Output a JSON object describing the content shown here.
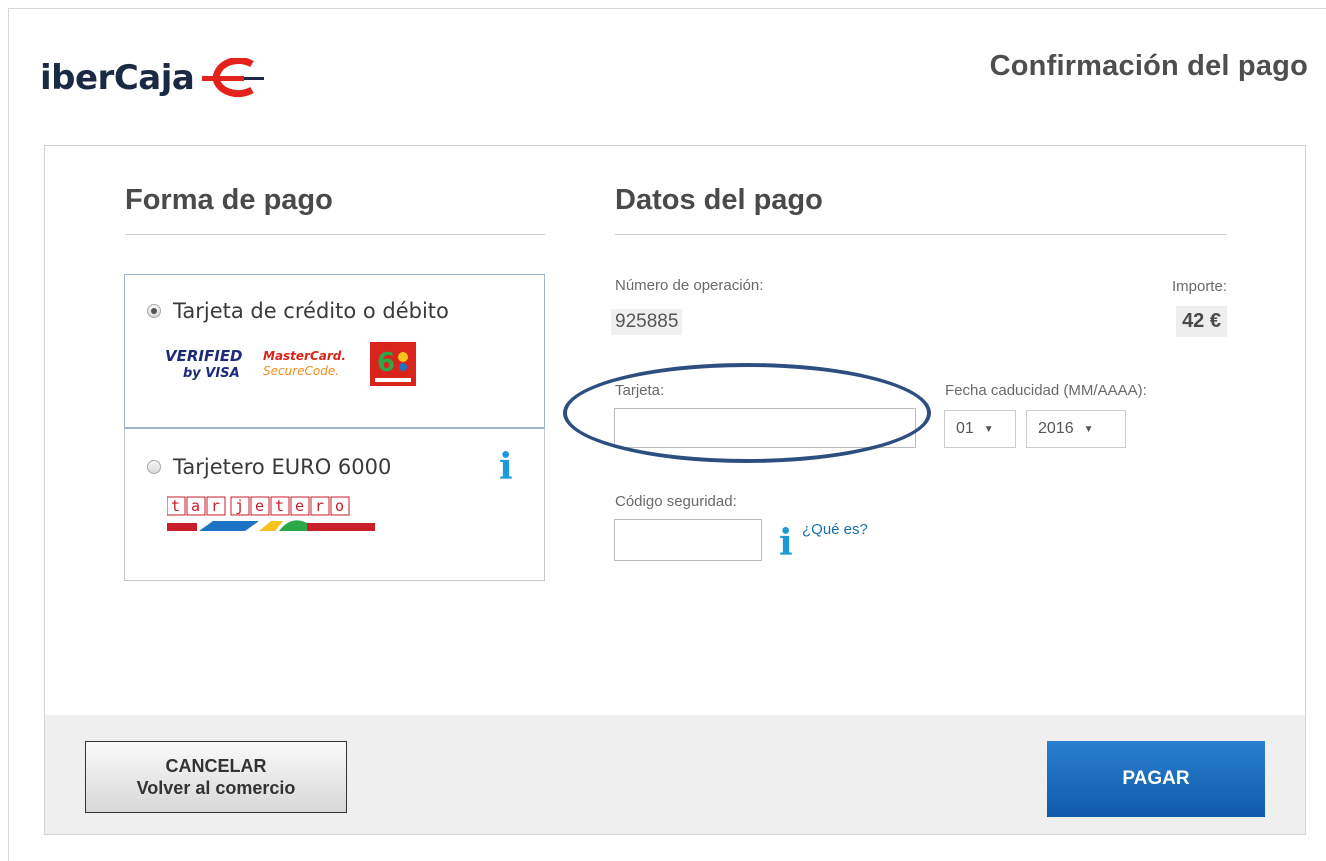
{
  "header": {
    "logo_text": "iberCaja",
    "title": "Confirmación del pago"
  },
  "left": {
    "section_title": "Forma de pago",
    "options": [
      {
        "label": "Tarjeta de crédito o débito",
        "selected": true,
        "brands": [
          "VERIFIED by VISA",
          "MasterCard. SecureCode.",
          "6000"
        ]
      },
      {
        "label": "Tarjetero EURO 6000",
        "selected": false,
        "brand": "tarjetero"
      }
    ]
  },
  "right": {
    "section_title": "Datos del pago",
    "operation_label": "Número de operación:",
    "operation_value": "925885",
    "amount_label": "Importe:",
    "amount_value": "42 €",
    "card_label": "Tarjeta:",
    "card_value": "",
    "expiry_label": "Fecha caducidad (MM/AAAA):",
    "expiry_month": "01",
    "expiry_year": "2016",
    "cvv_label": "Código seguridad:",
    "cvv_value": "",
    "help_link": "¿Qué es?"
  },
  "footer": {
    "cancel_line1": "CANCELAR",
    "cancel_line2": "Volver al comercio",
    "pay_label": "PAGAR"
  },
  "colors": {
    "pay_button": "#1866b8",
    "info_icon": "#1a9ad6",
    "annotation_ellipse": "#2d4e7e"
  }
}
